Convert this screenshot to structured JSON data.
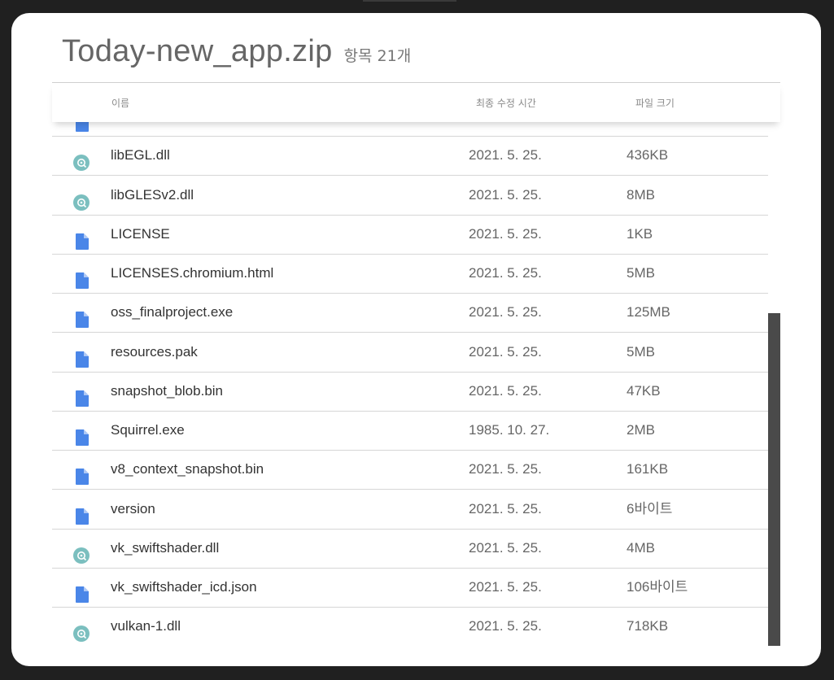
{
  "window": {
    "title": "Today-new_app.zip",
    "item_count": "항목 21개"
  },
  "header": {
    "name": "이름",
    "modified": "최종 수정 시간",
    "size": "파일 크기"
  },
  "files": [
    {
      "name": "",
      "date": "",
      "size": "",
      "icon": "file-icon",
      "partial": true
    },
    {
      "name": "libEGL.dll",
      "date": "2021. 5. 25.",
      "size": "436KB",
      "icon": "dll-icon"
    },
    {
      "name": "libGLESv2.dll",
      "date": "2021. 5. 25.",
      "size": "8MB",
      "icon": "dll-icon"
    },
    {
      "name": "LICENSE",
      "date": "2021. 5. 25.",
      "size": "1KB",
      "icon": "file-icon"
    },
    {
      "name": "LICENSES.chromium.html",
      "date": "2021. 5. 25.",
      "size": "5MB",
      "icon": "file-icon"
    },
    {
      "name": "oss_finalproject.exe",
      "date": "2021. 5. 25.",
      "size": "125MB",
      "icon": "file-icon"
    },
    {
      "name": "resources.pak",
      "date": "2021. 5. 25.",
      "size": "5MB",
      "icon": "file-icon"
    },
    {
      "name": "snapshot_blob.bin",
      "date": "2021. 5. 25.",
      "size": "47KB",
      "icon": "file-icon"
    },
    {
      "name": "Squirrel.exe",
      "date": "1985. 10. 27.",
      "size": "2MB",
      "icon": "file-icon"
    },
    {
      "name": "v8_context_snapshot.bin",
      "date": "2021. 5. 25.",
      "size": "161KB",
      "icon": "file-icon"
    },
    {
      "name": "version",
      "date": "2021. 5. 25.",
      "size": "6바이트",
      "icon": "file-icon"
    },
    {
      "name": "vk_swiftshader.dll",
      "date": "2021. 5. 25.",
      "size": "4MB",
      "icon": "dll-icon"
    },
    {
      "name": "vk_swiftshader_icd.json",
      "date": "2021. 5. 25.",
      "size": "106바이트",
      "icon": "file-icon"
    },
    {
      "name": "vulkan-1.dll",
      "date": "2021. 5. 25.",
      "size": "718KB",
      "icon": "dll-icon"
    }
  ],
  "colors": {
    "file_icon": "#4a86e8",
    "dll_icon": "#7bbfbf"
  }
}
